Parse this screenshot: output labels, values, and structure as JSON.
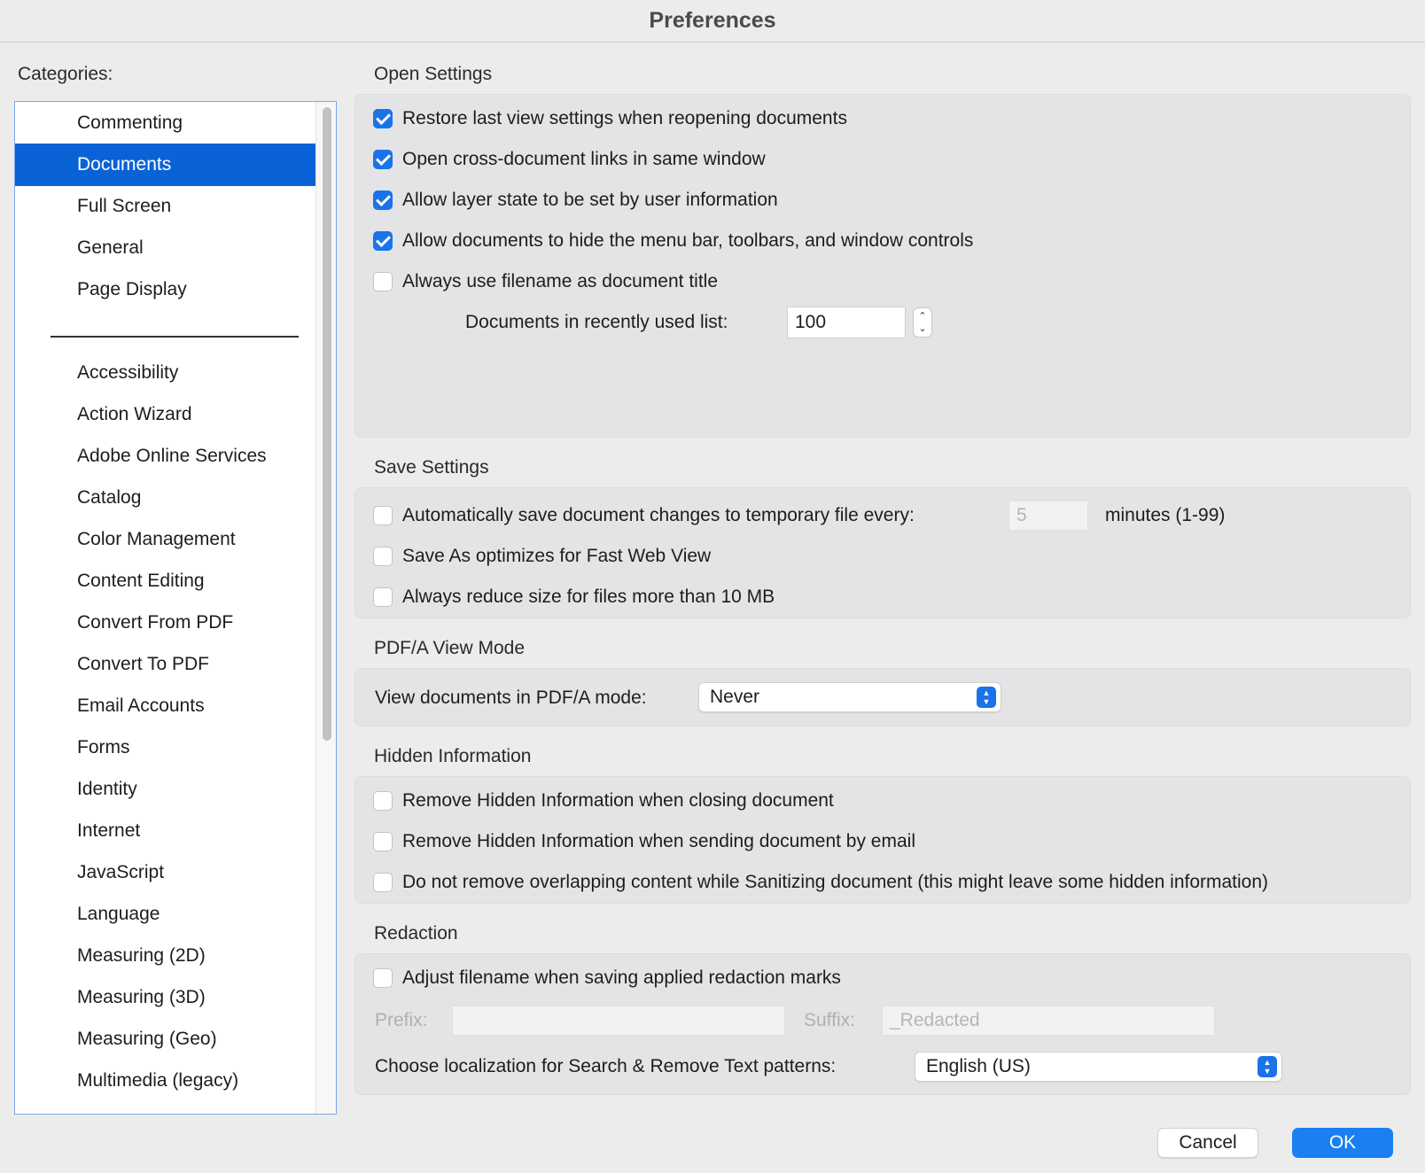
{
  "window": {
    "title": "Preferences"
  },
  "sidebar": {
    "label": "Categories:",
    "top_items": [
      {
        "label": "Commenting"
      },
      {
        "label": "Documents",
        "selected": true
      },
      {
        "label": "Full Screen"
      },
      {
        "label": "General"
      },
      {
        "label": "Page Display"
      }
    ],
    "items": [
      {
        "label": "Accessibility"
      },
      {
        "label": "Action Wizard"
      },
      {
        "label": "Adobe Online Services"
      },
      {
        "label": "Catalog"
      },
      {
        "label": "Color Management"
      },
      {
        "label": "Content Editing"
      },
      {
        "label": "Convert From PDF"
      },
      {
        "label": "Convert To PDF"
      },
      {
        "label": "Email Accounts"
      },
      {
        "label": "Forms"
      },
      {
        "label": "Identity"
      },
      {
        "label": "Internet"
      },
      {
        "label": "JavaScript"
      },
      {
        "label": "Language"
      },
      {
        "label": "Measuring (2D)"
      },
      {
        "label": "Measuring (3D)"
      },
      {
        "label": "Measuring (Geo)"
      },
      {
        "label": "Multimedia (legacy)"
      }
    ]
  },
  "open_settings": {
    "title": "Open Settings",
    "options": [
      {
        "label": "Restore last view settings when reopening documents",
        "checked": true
      },
      {
        "label": "Open cross-document links in same window",
        "checked": true
      },
      {
        "label": "Allow layer state to be set by user information",
        "checked": true
      },
      {
        "label": "Allow documents to hide the menu bar, toolbars, and window controls",
        "checked": true
      },
      {
        "label": "Always use filename as document title",
        "checked": false
      }
    ],
    "recent_list_label": "Documents in recently used list:",
    "recent_list_value": "100"
  },
  "save_settings": {
    "title": "Save Settings",
    "autosave_label": "Automatically save document changes to temporary file every:",
    "autosave_checked": false,
    "autosave_value": "5",
    "autosave_unit": "minutes (1-99)",
    "fast_web_label": "Save As optimizes for Fast Web View",
    "fast_web_checked": false,
    "reduce_size_label": "Always reduce size for files more than 10 MB",
    "reduce_size_checked": false
  },
  "pdfa": {
    "title": "PDF/A View Mode",
    "label": "View documents in PDF/A mode:",
    "value": "Never"
  },
  "hidden_info": {
    "title": "Hidden Information",
    "options": [
      {
        "label": "Remove Hidden Information when closing document",
        "checked": false
      },
      {
        "label": "Remove Hidden Information when sending document by email",
        "checked": false
      },
      {
        "label": "Do not remove overlapping content while Sanitizing document (this might leave some hidden information)",
        "checked": false
      }
    ]
  },
  "redaction": {
    "title": "Redaction",
    "adjust_label": "Adjust filename when saving applied redaction marks",
    "adjust_checked": false,
    "prefix_label": "Prefix:",
    "prefix_value": "",
    "suffix_label": "Suffix:",
    "suffix_value": "_Redacted",
    "localization_label": "Choose localization for Search & Remove Text patterns:",
    "localization_value": "English (US)"
  },
  "buttons": {
    "cancel": "Cancel",
    "ok": "OK"
  }
}
